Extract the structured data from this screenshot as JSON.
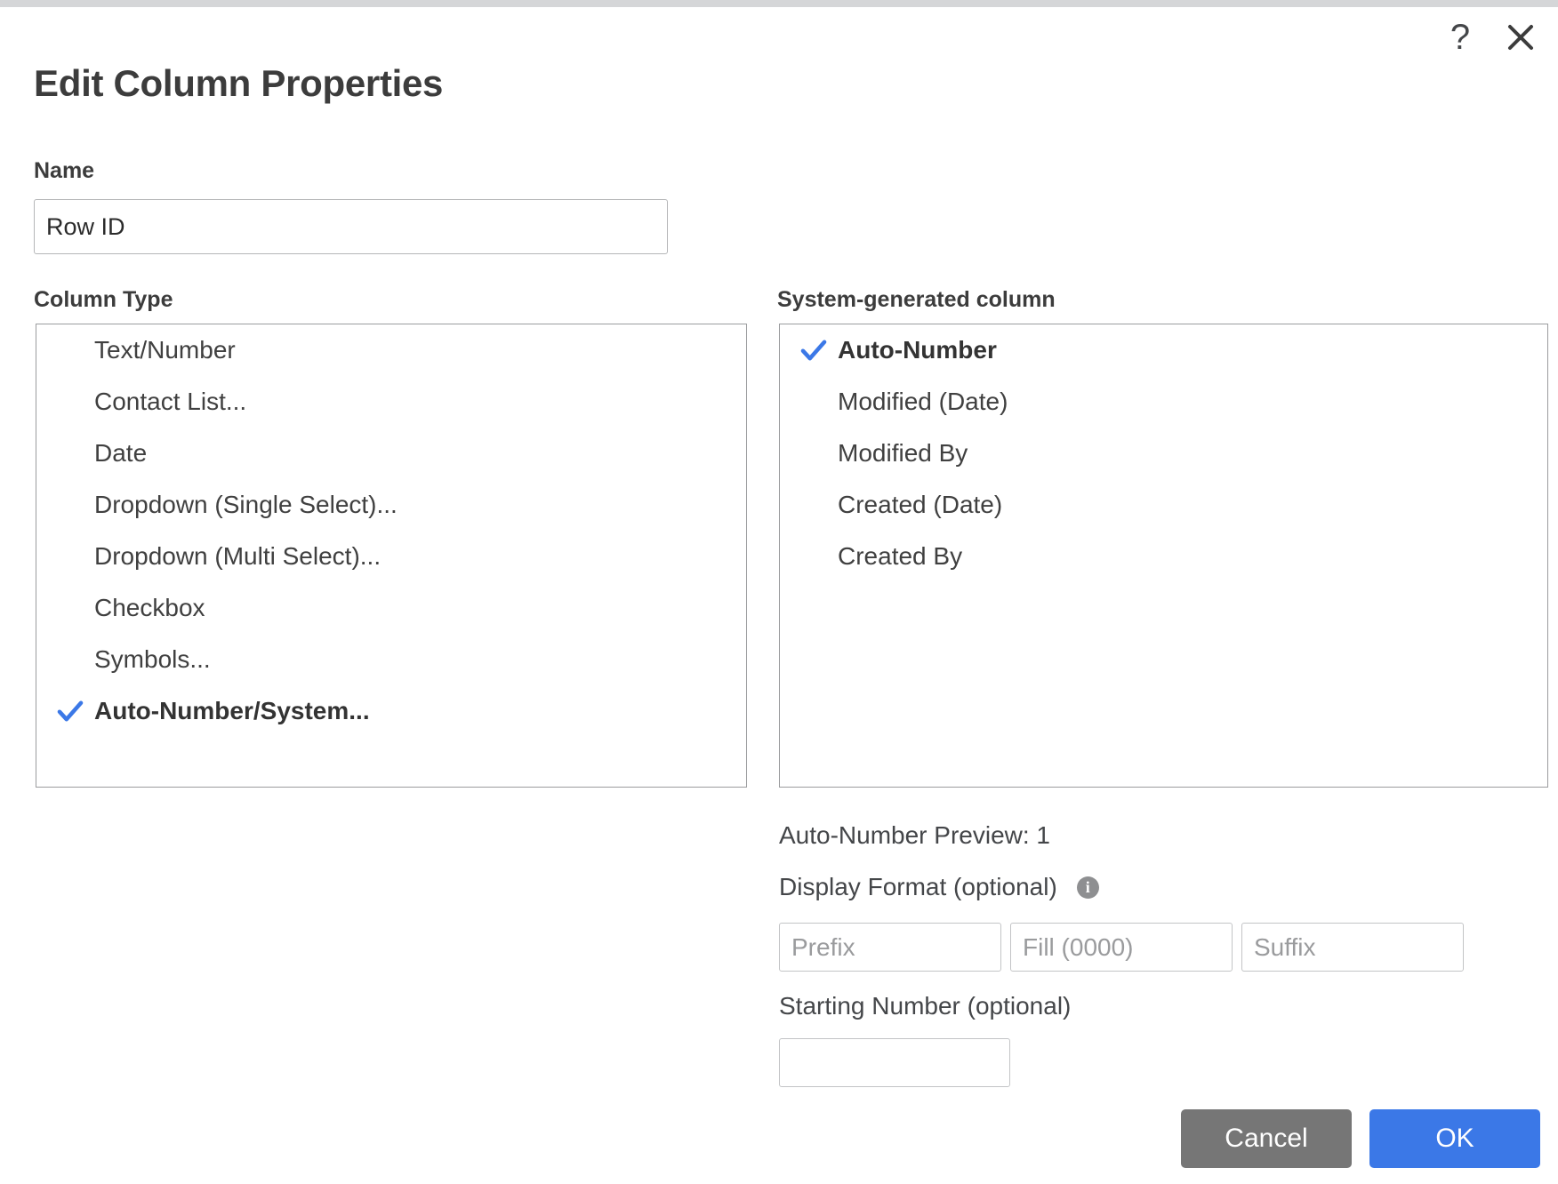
{
  "dialog": {
    "title": "Edit Column Properties",
    "help_icon": "question-mark-icon",
    "close_icon": "close-icon"
  },
  "name_field": {
    "label": "Name",
    "value": "Row ID",
    "placeholder": ""
  },
  "column_type": {
    "label": "Column Type",
    "items": [
      {
        "label": "Text/Number",
        "selected": false
      },
      {
        "label": "Contact List...",
        "selected": false
      },
      {
        "label": "Date",
        "selected": false
      },
      {
        "label": "Dropdown (Single Select)...",
        "selected": false
      },
      {
        "label": "Dropdown (Multi Select)...",
        "selected": false
      },
      {
        "label": "Checkbox",
        "selected": false
      },
      {
        "label": "Symbols...",
        "selected": false
      },
      {
        "label": "Auto-Number/System...",
        "selected": true
      }
    ]
  },
  "system_generated": {
    "label": "System-generated column",
    "items": [
      {
        "label": "Auto-Number",
        "selected": true
      },
      {
        "label": "Modified (Date)",
        "selected": false
      },
      {
        "label": "Modified By",
        "selected": false
      },
      {
        "label": "Created (Date)",
        "selected": false
      },
      {
        "label": "Created By",
        "selected": false
      }
    ]
  },
  "auto_number": {
    "preview": "Auto-Number Preview: 1",
    "display_format_label": "Display Format (optional)",
    "info_icon": "info-icon",
    "info_glyph": "i",
    "prefix": {
      "placeholder": "Prefix",
      "value": ""
    },
    "fill": {
      "placeholder": "Fill (0000)",
      "value": ""
    },
    "suffix": {
      "placeholder": "Suffix",
      "value": ""
    },
    "starting_number_label": "Starting Number (optional)",
    "starting_number": {
      "placeholder": "",
      "value": ""
    }
  },
  "footer": {
    "cancel_label": "Cancel",
    "ok_label": "OK"
  },
  "colors": {
    "accent": "#3b78e7",
    "cancel": "#767676",
    "text": "#3c3c3c",
    "border": "#9b9c9e",
    "top_strip": "#d5d6d8"
  }
}
